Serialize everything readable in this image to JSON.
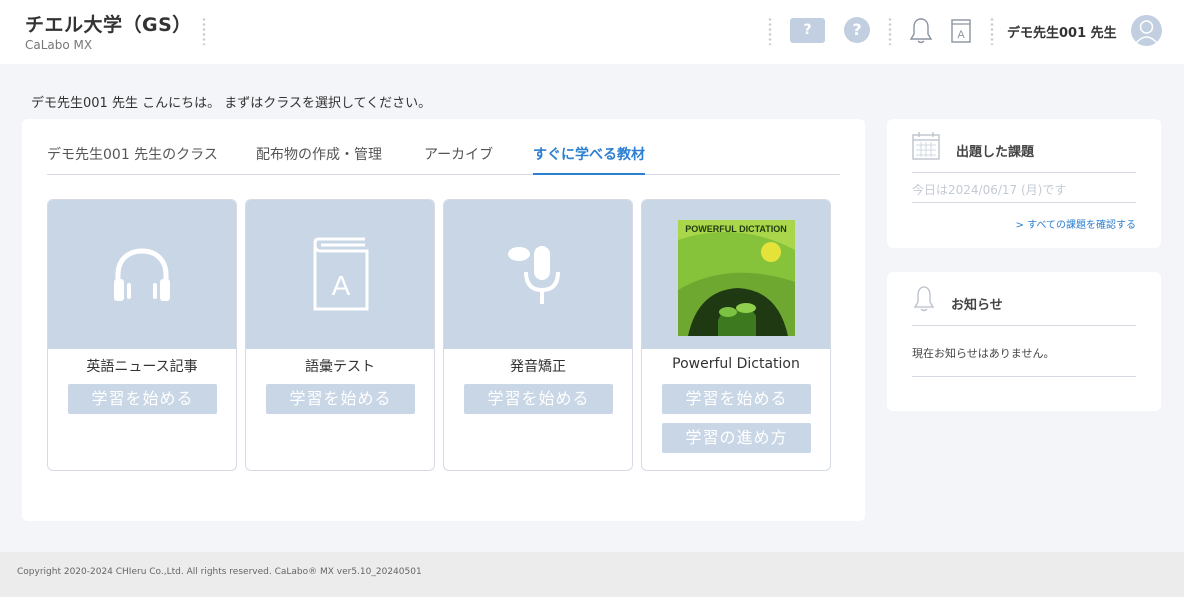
{
  "header": {
    "title": "チエル大学（GS）",
    "subtitle": "CaLabo MX",
    "help_button": "?",
    "help_circle": "?",
    "user_name": "デモ先生001 先生"
  },
  "greeting": "デモ先生001 先生 こんにちは。 まずはクラスを選択してください。",
  "tabs": [
    {
      "label": "デモ先生001 先生のクラス",
      "active": false
    },
    {
      "label": "配布物の作成・管理",
      "active": false
    },
    {
      "label": "アーカイブ",
      "active": false
    },
    {
      "label": "すぐに学べる教材",
      "active": true
    }
  ],
  "materials": [
    {
      "title": "英語ニュース記事",
      "icon": "headphones-icon",
      "buttons": [
        "学習を始める"
      ]
    },
    {
      "title": "語彙テスト",
      "icon": "book-a-icon",
      "buttons": [
        "学習を始める"
      ]
    },
    {
      "title": "発音矯正",
      "icon": "speech-mic-icon",
      "buttons": [
        "学習を始める"
      ]
    },
    {
      "title": "Powerful Dictation",
      "icon": "book-cover-image",
      "cover_title": "POWERFUL DICTATION",
      "buttons": [
        "学習を始める",
        "学習の進め方"
      ]
    }
  ],
  "assignments": {
    "title": "出題した課題",
    "today": "今日は2024/06/17 (月)です",
    "link": "> すべての課題を確認する"
  },
  "notices": {
    "title": "お知らせ",
    "empty": "現在お知らせはありません。"
  },
  "footer": "Copyright 2020-2024 CHIeru Co.,Ltd. All rights reserved. CaLabo® MX ver5.10_20240501",
  "colors": {
    "accent": "#2d7fd1",
    "tile": "#c9d6e6",
    "icon_bg": "#c2cfe0"
  }
}
